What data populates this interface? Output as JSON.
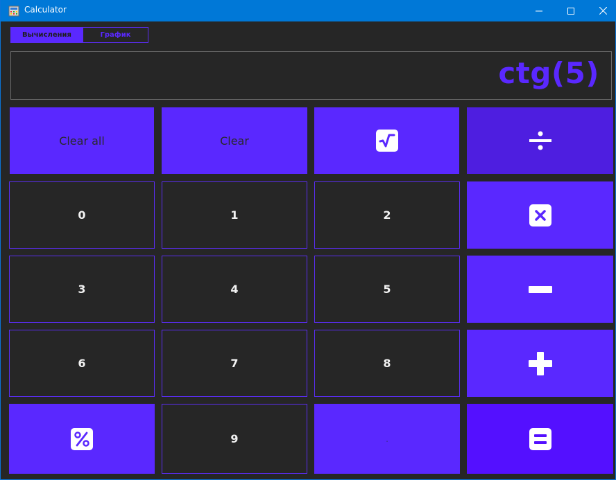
{
  "window": {
    "title": "Calculator",
    "icon": "calculator-app-icon"
  },
  "title_controls": {
    "minimize": "minimize-icon",
    "maximize": "maximize-icon",
    "close": "close-icon"
  },
  "tabs": [
    {
      "label": "Вычисления",
      "active": true
    },
    {
      "label": "График",
      "active": false
    }
  ],
  "display": {
    "expression": "ctg(5)"
  },
  "buttons": {
    "clear_all": "Clear all",
    "clear": "Clear",
    "sqrt": "square-root-icon",
    "divide": "divide-icon",
    "multiply": "multiply-icon",
    "minus": "minus-icon",
    "plus": "plus-icon",
    "percent": "percent-icon",
    "equals": "equals-icon",
    "dot": "."
  },
  "digits": [
    "0",
    "1",
    "2",
    "3",
    "4",
    "5",
    "6",
    "7",
    "8",
    "9"
  ],
  "colors": {
    "accent": "#5a28ff",
    "background": "#262626",
    "titlebar": "#0078d7",
    "digit_text": "#f2f2f2"
  }
}
